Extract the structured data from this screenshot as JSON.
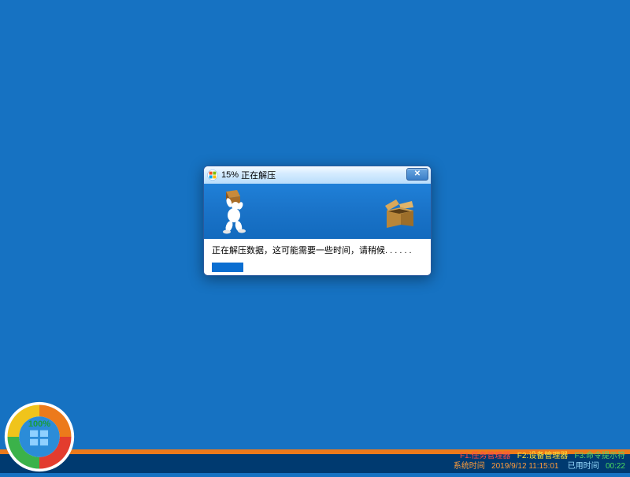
{
  "dialog": {
    "title_percent": "15%",
    "title_text": "正在解压",
    "message": "正在解压数据，这可能需要一些时间，请稍候. . . . . .",
    "progress_percent": 15
  },
  "statusbar": {
    "f1": "F1:任务管理器",
    "f2": "F2:设备管理器",
    "f3": "F3:命令提示符",
    "sys_label": "系统时间",
    "sys_time": "2019/9/12 11:15:01",
    "elapsed_label": "已用时间",
    "elapsed_value": "00:22"
  },
  "badge": {
    "percent_text": "100%"
  }
}
